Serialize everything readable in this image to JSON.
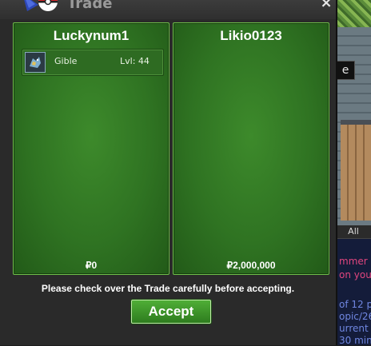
{
  "window": {
    "title": "Trade",
    "close_label": "×"
  },
  "left_trader": {
    "name": "Luckynum1",
    "pokemon": [
      {
        "name": "Gible",
        "level_text": "Lvl: 44",
        "icon": "gible-sprite-icon"
      }
    ],
    "money": "₽0"
  },
  "right_trader": {
    "name": "Likio0123",
    "pokemon": [],
    "money": "₽2,000,000"
  },
  "notice": "Please check over the Trade carefully before accepting.",
  "accept_label": "Accept",
  "background": {
    "tooltip_fragment": "e",
    "chat_tab_label": "All",
    "chat_lines": [
      {
        "text": "mmer N",
        "color": "#e0457e"
      },
      {
        "text": "on you'r",
        "color": "#e0457e"
      },
      {
        "text": "of 12 p",
        "color": "#6f86e0"
      },
      {
        "text": "opic/26",
        "color": "#6f86e0"
      },
      {
        "text": "urrent o",
        "color": "#6f86e0"
      },
      {
        "text": "30 min",
        "color": "#6f86e0"
      }
    ]
  },
  "colors": {
    "panel_green": "#2f7322",
    "panel_border": "#6fbf4a",
    "button_green": "#3f9a2b"
  }
}
